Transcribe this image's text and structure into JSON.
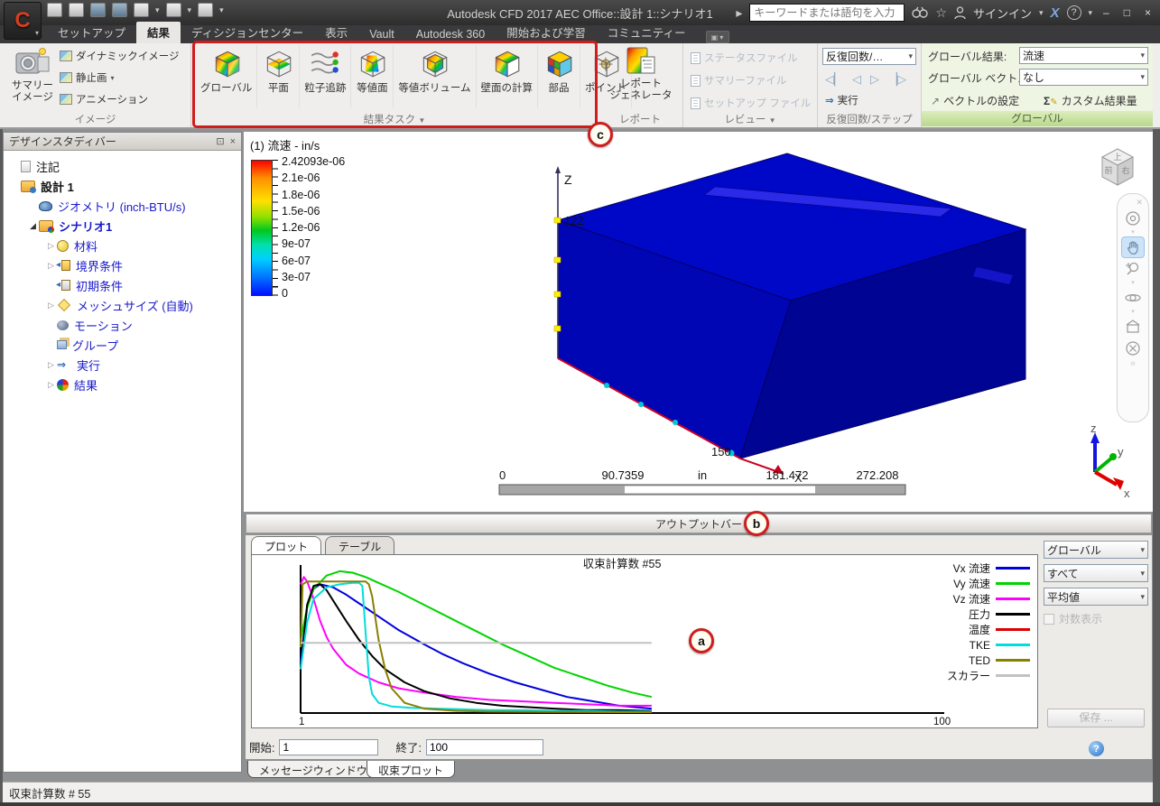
{
  "window": {
    "title": "Autodesk CFD 2017   AEC Office::設計 1::シナリオ1",
    "search_placeholder": "キーワードまたは語句を入力",
    "signin_label": "サインイン",
    "qat_icons": [
      "new-document",
      "open",
      "save",
      "save-as",
      "orientation-cube",
      "appearance-cube",
      "design-review-table",
      "customize-arrow"
    ],
    "titlebar_icons": [
      "search-binoculars",
      "favorites-star",
      "user",
      "exchange-x",
      "help"
    ],
    "window_controls": [
      "minimize",
      "maximize",
      "close"
    ]
  },
  "tabs": [
    {
      "label": "セットアップ",
      "active": false
    },
    {
      "label": "結果",
      "active": true
    },
    {
      "label": "ディシジョンセンター",
      "active": false
    },
    {
      "label": "表示",
      "active": false
    },
    {
      "label": "Vault",
      "active": false
    },
    {
      "label": "Autodesk 360",
      "active": false
    },
    {
      "label": "開始および学習",
      "active": false
    },
    {
      "label": "コミュニティー",
      "active": false
    }
  ],
  "ribbon": {
    "image_group": {
      "label": "イメージ",
      "big_button_lines": [
        "サマリー",
        "イメージ"
      ],
      "items": [
        {
          "label": "ダイナミックイメージ",
          "arrow": false
        },
        {
          "label": "静止画",
          "arrow": true
        },
        {
          "label": "アニメーション",
          "arrow": false
        }
      ]
    },
    "task_group": {
      "label": "結果タスク",
      "buttons": [
        {
          "label": "グローバル",
          "icon": "global"
        },
        {
          "label": "平面",
          "icon": "plane"
        },
        {
          "label": "粒子追跡",
          "icon": "traces"
        },
        {
          "label": "等値面",
          "icon": "isosurface"
        },
        {
          "label": "等値ボリューム",
          "icon": "isovolume"
        },
        {
          "label": "壁面の計算",
          "icon": "wall"
        },
        {
          "label": "部品",
          "icon": "parts"
        },
        {
          "label": "ポイント",
          "icon": "point"
        }
      ]
    },
    "report_group": {
      "label": "レポート",
      "button_lines": [
        "レポート",
        "ジェネレータ"
      ]
    },
    "review_group": {
      "label": "レビュー",
      "items": [
        "ステータスファイル",
        "サマリーファイル",
        "セットアップ ファイル"
      ]
    },
    "iteration_group": {
      "label": "反復回数/ステップ",
      "dropdown_value": "反復回数/…",
      "run_label": "実行"
    },
    "global_group": {
      "label": "グローバル",
      "result_label": "グローバル結果:",
      "result_value": "流速",
      "vector_label": "グローバル ベクトル:",
      "vector_value": "なし",
      "vector_settings_label": "ベクトルの設定",
      "custom_result_label": "カスタム結果量"
    }
  },
  "design_bar": {
    "title": "デザインスタディバー",
    "tree": [
      {
        "label": "注記",
        "icon": "note",
        "color": "#111111",
        "bold": false,
        "arrow": "",
        "indent": 0
      },
      {
        "label": "設計 1",
        "icon": "design",
        "color": "#111111",
        "bold": true,
        "arrow": "",
        "indent": 0
      },
      {
        "label": "ジオメトリ (inch-BTU/s)",
        "icon": "geometry",
        "color": "#1a1acc",
        "bold": false,
        "arrow": "",
        "indent": 1
      },
      {
        "label": "シナリオ1",
        "icon": "scenario",
        "color": "#1a1acc",
        "bold": true,
        "arrow": "open",
        "indent": 1
      },
      {
        "label": "材料",
        "icon": "material",
        "color": "#1a1acc",
        "bold": false,
        "arrow": "closed",
        "indent": 2
      },
      {
        "label": "境界条件",
        "icon": "boundary",
        "color": "#1a1acc",
        "bold": false,
        "arrow": "closed",
        "indent": 2
      },
      {
        "label": "初期条件",
        "icon": "initial",
        "color": "#1a1acc",
        "bold": false,
        "arrow": "",
        "indent": 2
      },
      {
        "label": "メッシュサイズ (自動)",
        "icon": "mesh",
        "color": "#1a1acc",
        "bold": false,
        "arrow": "closed",
        "indent": 2
      },
      {
        "label": "モーション",
        "icon": "motion",
        "color": "#1a1acc",
        "bold": false,
        "arrow": "",
        "indent": 2
      },
      {
        "label": "グループ",
        "icon": "group",
        "color": "#1a1acc",
        "bold": false,
        "arrow": "",
        "indent": 2
      },
      {
        "label": "実行",
        "icon": "run",
        "color": "#1a1acc",
        "bold": false,
        "arrow": "closed",
        "indent": 2
      },
      {
        "label": "結果",
        "icon": "result",
        "color": "#1a1acc",
        "bold": false,
        "arrow": "closed",
        "indent": 2
      }
    ]
  },
  "viewport": {
    "colorbar": {
      "title": "(1) 流速 - in/s",
      "values": [
        "2.42093e-06",
        "2.1e-06",
        "1.8e-06",
        "1.5e-06",
        "1.2e-06",
        "9e-07",
        "6e-07",
        "3e-07",
        "0"
      ]
    },
    "z_axis_label": "Z",
    "z_tick_label": "122",
    "x_corner_label": "150",
    "x_axis_label": "X",
    "ruler": {
      "ticks": [
        "0",
        "90.7359",
        "181.472",
        "272.208"
      ],
      "unit": "in"
    },
    "viewcube_faces": {
      "top": "上",
      "front": "前",
      "right": "右"
    },
    "triad_labels": {
      "x": "x",
      "y": "y",
      "z": "z"
    },
    "nav_icons": [
      "close-icon",
      "steering-wheel-icon",
      "pan-hand-icon",
      "zoom-icon",
      "orbit-icon",
      "look-at-icon",
      "zoom-fit-icon",
      "collapse-icon"
    ]
  },
  "output_bar": {
    "title": "アウトプットバー"
  },
  "plot_panel": {
    "tabs": [
      {
        "label": "プロット",
        "active": true
      },
      {
        "label": "テーブル",
        "active": false
      }
    ],
    "dropdowns": [
      "グローバル",
      "すべて",
      "平均値"
    ],
    "log_checkbox_label": "対数表示",
    "save_button_label": "保存 ...",
    "start_label": "開始:",
    "start_value": "1",
    "end_label": "終了:",
    "end_value": "100"
  },
  "chart_data": {
    "type": "line",
    "title": "収束計算数 #55",
    "xlim": [
      1,
      100
    ],
    "ylim": [
      0,
      1
    ],
    "xtick_labels": [
      "1",
      "100"
    ],
    "data_end_x": 55,
    "note": "y values are normalized residual heights (no y axis labels shown); run stopped at iteration 55 of 100",
    "legend_position": "right",
    "grid": false,
    "series": [
      {
        "name": "Vx 流速",
        "color": "#0000dd",
        "x": [
          1,
          2,
          3,
          4,
          6,
          8,
          10,
          12,
          14,
          16,
          18,
          20,
          23,
          26,
          30,
          34,
          38,
          42,
          46,
          50,
          55
        ],
        "values": [
          0.35,
          0.72,
          0.85,
          0.88,
          0.86,
          0.81,
          0.75,
          0.69,
          0.63,
          0.57,
          0.52,
          0.47,
          0.4,
          0.34,
          0.27,
          0.21,
          0.16,
          0.11,
          0.08,
          0.05,
          0.03
        ]
      },
      {
        "name": "Vy 流速",
        "color": "#00d400",
        "x": [
          1,
          2,
          3,
          5,
          7,
          9,
          11,
          13,
          16,
          20,
          24,
          28,
          32,
          36,
          40,
          44,
          48,
          52,
          55
        ],
        "values": [
          0.5,
          0.72,
          0.85,
          0.94,
          0.97,
          0.96,
          0.93,
          0.89,
          0.83,
          0.74,
          0.65,
          0.56,
          0.47,
          0.39,
          0.31,
          0.25,
          0.19,
          0.14,
          0.11
        ]
      },
      {
        "name": "Vz 流速",
        "color": "#ff00ff",
        "x": [
          1,
          1.5,
          2,
          3,
          4,
          5,
          6,
          8,
          10,
          13,
          16,
          20,
          25,
          30,
          35,
          40,
          45,
          50,
          55
        ],
        "values": [
          0.88,
          0.93,
          0.9,
          0.78,
          0.63,
          0.52,
          0.44,
          0.33,
          0.27,
          0.21,
          0.17,
          0.14,
          0.11,
          0.09,
          0.08,
          0.07,
          0.06,
          0.05,
          0.05
        ]
      },
      {
        "name": "圧力",
        "color": "#000000",
        "x": [
          1,
          2,
          3,
          4,
          5,
          6,
          8,
          10,
          12,
          14,
          17,
          20,
          24,
          28,
          32,
          36,
          40,
          45,
          50,
          55
        ],
        "values": [
          0.3,
          0.74,
          0.87,
          0.88,
          0.84,
          0.77,
          0.63,
          0.5,
          0.39,
          0.3,
          0.21,
          0.15,
          0.1,
          0.07,
          0.05,
          0.04,
          0.03,
          0.02,
          0.02,
          0.015
        ]
      },
      {
        "name": "温度",
        "color": "#dd0000",
        "x": [],
        "values": []
      },
      {
        "name": "TKE",
        "color": "#00dddd",
        "x": [
          1,
          2,
          3,
          5,
          7,
          9,
          10,
          10.5,
          11,
          11.5,
          12,
          13,
          15,
          18,
          22,
          26,
          30,
          35,
          40,
          45,
          50,
          55
        ],
        "values": [
          0.3,
          0.62,
          0.78,
          0.86,
          0.88,
          0.89,
          0.89,
          0.87,
          0.55,
          0.25,
          0.13,
          0.07,
          0.045,
          0.035,
          0.03,
          0.025,
          0.02,
          0.02,
          0.015,
          0.015,
          0.01,
          0.01
        ]
      },
      {
        "name": "TED",
        "color": "#8a8000",
        "x": [
          1,
          1.3,
          2,
          11,
          11.5,
          12,
          12.5,
          13,
          14,
          15,
          17,
          20,
          25,
          30,
          40,
          50,
          55
        ],
        "values": [
          0.45,
          0.88,
          0.9,
          0.9,
          0.88,
          0.8,
          0.65,
          0.5,
          0.3,
          0.17,
          0.07,
          0.03,
          0.015,
          0.01,
          0.008,
          0.006,
          0.006
        ]
      },
      {
        "name": "スカラー",
        "color": "#c2c2c2",
        "x": [
          1,
          55
        ],
        "values": [
          0.48,
          0.48
        ]
      }
    ]
  },
  "bottom_tabs": [
    {
      "label": "メッセージウィンドウ",
      "active": false
    },
    {
      "label": "収束プロット",
      "active": true
    }
  ],
  "status_bar": {
    "text": "収束計算数 # 55"
  },
  "annotations": {
    "a": "a",
    "b": "b",
    "c": "c"
  }
}
